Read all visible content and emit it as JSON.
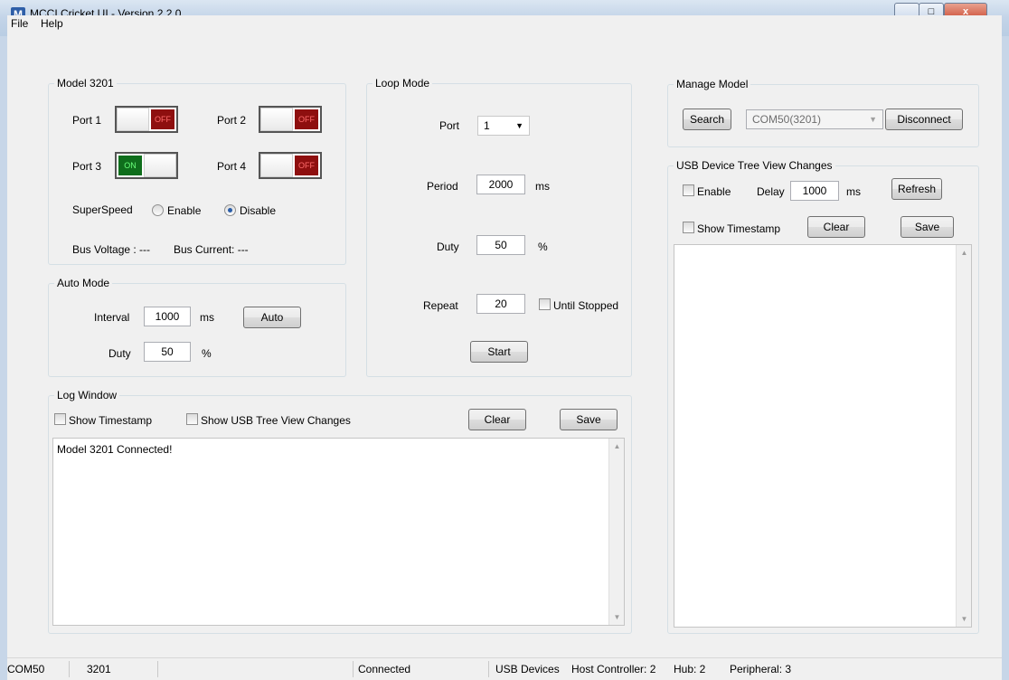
{
  "window": {
    "title": "MCCI Cricket UI - Version 2.2.0",
    "logo_letter": "M",
    "minimize_glyph": "▁",
    "maximize_glyph": "□",
    "close_glyph": "x"
  },
  "menu": {
    "items": [
      "File",
      "Help"
    ]
  },
  "model": {
    "group_title": "Model 3201",
    "ports": [
      {
        "label": "Port 1",
        "state": "OFF"
      },
      {
        "label": "Port 2",
        "state": "OFF"
      },
      {
        "label": "Port 3",
        "state": "ON"
      },
      {
        "label": "Port 4",
        "state": "OFF"
      }
    ],
    "superspeed_label": "SuperSpeed",
    "superspeed_options": [
      "Enable",
      "Disable"
    ],
    "superspeed_selected": "Disable",
    "bus_voltage_label": "Bus Voltage : ---",
    "bus_current_label": "Bus Current: ---"
  },
  "auto_mode": {
    "group_title": "Auto Mode",
    "interval_label": "Interval",
    "interval_value": "1000",
    "interval_unit": "ms",
    "auto_button": "Auto",
    "duty_label": "Duty",
    "duty_value": "50",
    "duty_unit": "%"
  },
  "loop_mode": {
    "group_title": "Loop Mode",
    "port_label": "Port",
    "port_value": "1",
    "period_label": "Period",
    "period_value": "2000",
    "period_unit": "ms",
    "duty_label": "Duty",
    "duty_value": "50",
    "duty_unit": "%",
    "repeat_label": "Repeat",
    "repeat_value": "20",
    "until_stopped_label": "Until Stopped",
    "start_button": "Start"
  },
  "log": {
    "group_title": "Log Window",
    "show_timestamp_label": "Show Timestamp",
    "show_usb_tree_label": "Show USB Tree View Changes",
    "clear_button": "Clear",
    "save_button": "Save",
    "text": "Model 3201 Connected!"
  },
  "manage": {
    "group_title": "Manage Model",
    "search_button": "Search",
    "port_value": "COM50(3201)",
    "disconnect_button": "Disconnect"
  },
  "usb_tree": {
    "group_title": "USB Device Tree View Changes",
    "enable_label": "Enable",
    "delay_label": "Delay",
    "delay_value": "1000",
    "delay_unit": "ms",
    "refresh_button": "Refresh",
    "show_timestamp_label": "Show Timestamp",
    "clear_button": "Clear",
    "save_button": "Save"
  },
  "status": {
    "com": "COM50",
    "model": "3201",
    "connection": "Connected",
    "usb_devices": "USB Devices",
    "host_controller": "Host Controller: 2",
    "hub": "Hub: 2",
    "peripheral": "Peripheral: 3"
  },
  "colors": {
    "toggle_off": "#8e0f0f",
    "toggle_on": "#0f6e1c",
    "panel_bg": "#f0f0f0"
  }
}
